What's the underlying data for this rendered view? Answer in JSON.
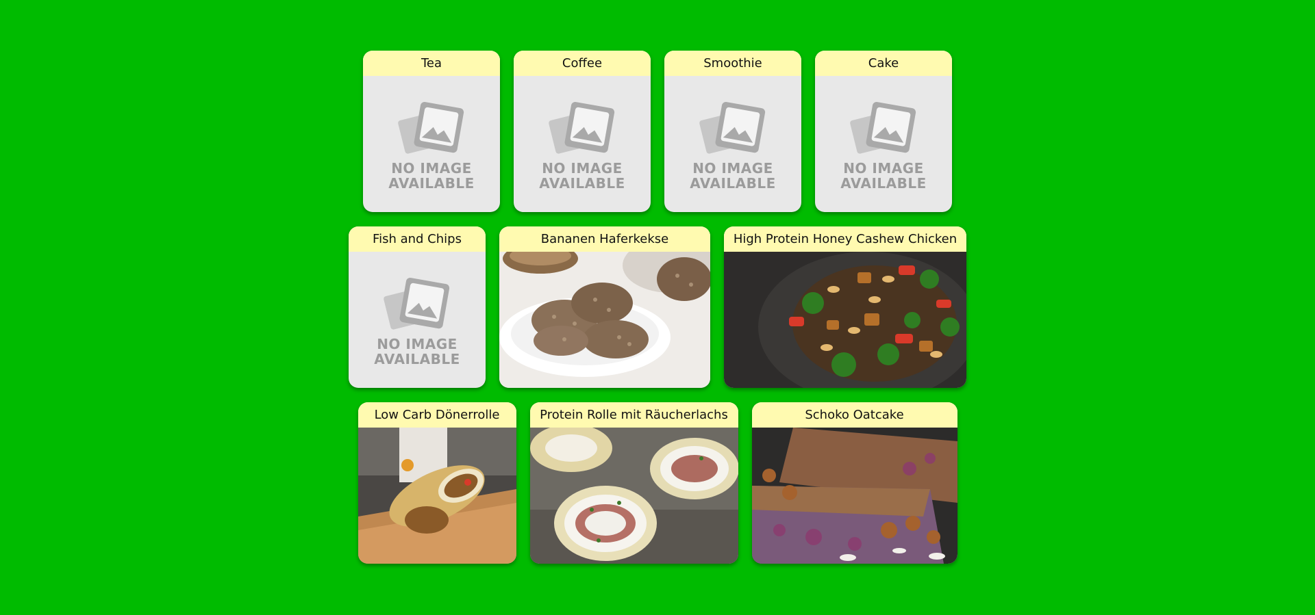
{
  "colors": {
    "background": "#00bb00",
    "card_header": "#fffab0",
    "card_body": "#e8e8e8",
    "placeholder_gray": "#9b9b9b"
  },
  "placeholder": {
    "line1": "NO IMAGE",
    "line2": "AVAILABLE",
    "icon": "no-image-photo-icon"
  },
  "rows": [
    {
      "cards": [
        {
          "title": "Tea",
          "image": "placeholder"
        },
        {
          "title": "Coffee",
          "image": "placeholder"
        },
        {
          "title": "Smoothie",
          "image": "placeholder"
        },
        {
          "title": "Cake",
          "image": "placeholder"
        }
      ]
    },
    {
      "cards": [
        {
          "title": "Fish and Chips",
          "image": "placeholder"
        },
        {
          "title": "Bananen Haferkekse",
          "image": "photo"
        },
        {
          "title": "High Protein Honey Cashew Chicken",
          "image": "photo"
        }
      ]
    },
    {
      "cards": [
        {
          "title": "Low Carb Dönerrolle",
          "image": "photo"
        },
        {
          "title": "Protein Rolle mit Räucherlachs",
          "image": "photo"
        },
        {
          "title": "Schoko Oatcake",
          "image": "photo"
        }
      ]
    }
  ]
}
